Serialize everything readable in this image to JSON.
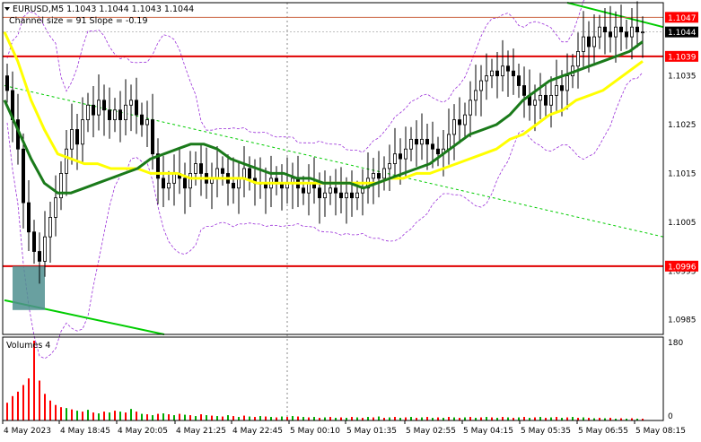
{
  "header": {
    "symbol_line": "EURUSD,M5  1.1043 1.1044 1.1043 1.1044",
    "indicator_line": "Channel size = 91 Slope = -0.19",
    "arrow": "triangle-down-icon"
  },
  "volume_panel": {
    "label": "Volumes 4",
    "ticks": [
      "180",
      "0"
    ]
  },
  "price_axis": {
    "ticks": [
      "1.1035",
      "1.1025",
      "1.1015",
      "1.1005",
      "1.0995",
      "1.0985"
    ],
    "badges": [
      {
        "text": "1.1047",
        "fill": "#ff0000",
        "color": "#ffffff"
      },
      {
        "text": "1.1044",
        "fill": "#000000",
        "color": "#ffffff"
      },
      {
        "text": "1.1039",
        "fill": "#ff0000",
        "color": "#ffffff"
      },
      {
        "text": "1.0996",
        "fill": "#ff0000",
        "color": "#ffffff"
      }
    ]
  },
  "time_axis": {
    "labels": [
      "4 May 2023",
      "4 May 18:45",
      "4 May 20:05",
      "4 May 21:25",
      "4 May 22:45",
      "5 May 00:10",
      "5 May 01:35",
      "5 May 02:55",
      "5 May 04:15",
      "5 May 05:35",
      "5 May 06:55",
      "5 May 08:15"
    ]
  },
  "chart_data": {
    "type": "candlestick",
    "symbol": "EURUSD",
    "timeframe": "M5",
    "ylim": [
      1.0982,
      1.105
    ],
    "levels": [
      1.1047,
      1.1039,
      1.0996
    ],
    "colors": {
      "ma_fast": "#1a7a1a",
      "ma_slow": "#ffff00",
      "bands": "#9b30d9",
      "level_line": "#e00000",
      "channel": "#00cc00",
      "highlight": "#4f8f8f"
    },
    "closes": [
      1.1032,
      1.1026,
      1.102,
      1.1009,
      1.1003,
      1.0999,
      1.0997,
      1.1002,
      1.1006,
      1.101,
      1.1015,
      1.102,
      1.1024,
      1.1021,
      1.1026,
      1.1029,
      1.1027,
      1.103,
      1.1028,
      1.1026,
      1.1028,
      1.1026,
      1.1029,
      1.103,
      1.1027,
      1.1025,
      1.1026,
      1.1019,
      1.1014,
      1.1012,
      1.1013,
      1.1015,
      1.1014,
      1.1012,
      1.1015,
      1.1017,
      1.1015,
      1.1013,
      1.1014,
      1.1016,
      1.1015,
      1.1013,
      1.1012,
      1.1014,
      1.1016,
      1.1014,
      1.1013,
      1.1013,
      1.1012,
      1.1014,
      1.1013,
      1.1012,
      1.1013,
      1.1014,
      1.1012,
      1.1011,
      1.1013,
      1.1012,
      1.101,
      1.1011,
      1.1012,
      1.1011,
      1.101,
      1.1011,
      1.101,
      1.1011,
      1.1012,
      1.1014,
      1.1015,
      1.1014,
      1.1016,
      1.1017,
      1.1019,
      1.1018,
      1.102,
      1.1022,
      1.1021,
      1.1022,
      1.1021,
      1.102,
      1.1019,
      1.102,
      1.1023,
      1.1026,
      1.1025,
      1.1027,
      1.103,
      1.1032,
      1.1034,
      1.1035,
      1.1036,
      1.1035,
      1.1037,
      1.1036,
      1.1035,
      1.1033,
      1.1031,
      1.1029,
      1.103,
      1.1031,
      1.1029,
      1.1031,
      1.1033,
      1.1032,
      1.1035,
      1.1037,
      1.104,
      1.1043,
      1.1041,
      1.1043,
      1.1045,
      1.1044,
      1.1043,
      1.1045,
      1.1044,
      1.1043,
      1.1045,
      1.1044,
      1.1044
    ],
    "ma_fast": [
      1.103,
      1.1024,
      1.1018,
      1.1013,
      1.1011,
      1.1011,
      1.1012,
      1.1013,
      1.1014,
      1.1015,
      1.1016,
      1.1018,
      1.1019,
      1.102,
      1.1021,
      1.1021,
      1.102,
      1.1018,
      1.1017,
      1.1016,
      1.1015,
      1.1015,
      1.1014,
      1.1014,
      1.1013,
      1.1013,
      1.1013,
      1.1012,
      1.1013,
      1.1014,
      1.1015,
      1.1016,
      1.1017,
      1.1019,
      1.1021,
      1.1023,
      1.1024,
      1.1025,
      1.1027,
      1.103,
      1.1032,
      1.1034,
      1.1035,
      1.1036,
      1.1037,
      1.1038,
      1.1039,
      1.104,
      1.1042
    ],
    "ma_slow": [
      1.1044,
      1.1038,
      1.103,
      1.1024,
      1.1019,
      1.1018,
      1.1017,
      1.1017,
      1.1016,
      1.1016,
      1.1016,
      1.1015,
      1.1015,
      1.1015,
      1.1014,
      1.1014,
      1.1014,
      1.1014,
      1.1014,
      1.1013,
      1.1013,
      1.1013,
      1.1013,
      1.1013,
      1.1013,
      1.1013,
      1.1013,
      1.1013,
      1.1013,
      1.1014,
      1.1014,
      1.1015,
      1.1015,
      1.1016,
      1.1017,
      1.1018,
      1.1019,
      1.102,
      1.1022,
      1.1023,
      1.1025,
      1.1027,
      1.1028,
      1.103,
      1.1031,
      1.1032,
      1.1034,
      1.1036,
      1.1038
    ],
    "volumes": [
      40,
      55,
      65,
      80,
      95,
      180,
      90,
      60,
      45,
      35,
      30,
      28,
      25,
      22,
      20,
      24,
      18,
      16,
      20,
      18,
      22,
      20,
      18,
      26,
      20,
      15,
      14,
      12,
      15,
      16,
      14,
      12,
      15,
      13,
      12,
      10,
      14,
      12,
      11,
      10,
      9,
      12,
      10,
      8,
      11,
      9,
      8,
      10,
      9,
      8,
      7,
      9,
      8,
      10,
      9,
      8,
      7,
      8,
      6,
      7,
      8,
      6,
      7,
      6,
      8,
      7,
      6,
      8,
      7,
      9,
      6,
      7,
      8,
      6,
      7,
      8,
      6,
      7,
      8,
      6,
      7,
      6,
      8,
      7,
      6,
      7,
      8,
      6,
      7,
      8,
      7,
      6,
      8,
      7,
      6,
      7,
      8,
      6,
      7,
      8,
      6,
      7,
      8,
      6,
      7,
      8,
      6,
      7,
      6,
      5,
      6,
      5,
      6,
      4,
      5,
      4,
      5,
      4,
      4
    ],
    "volume_ylim": [
      0,
      180
    ]
  }
}
